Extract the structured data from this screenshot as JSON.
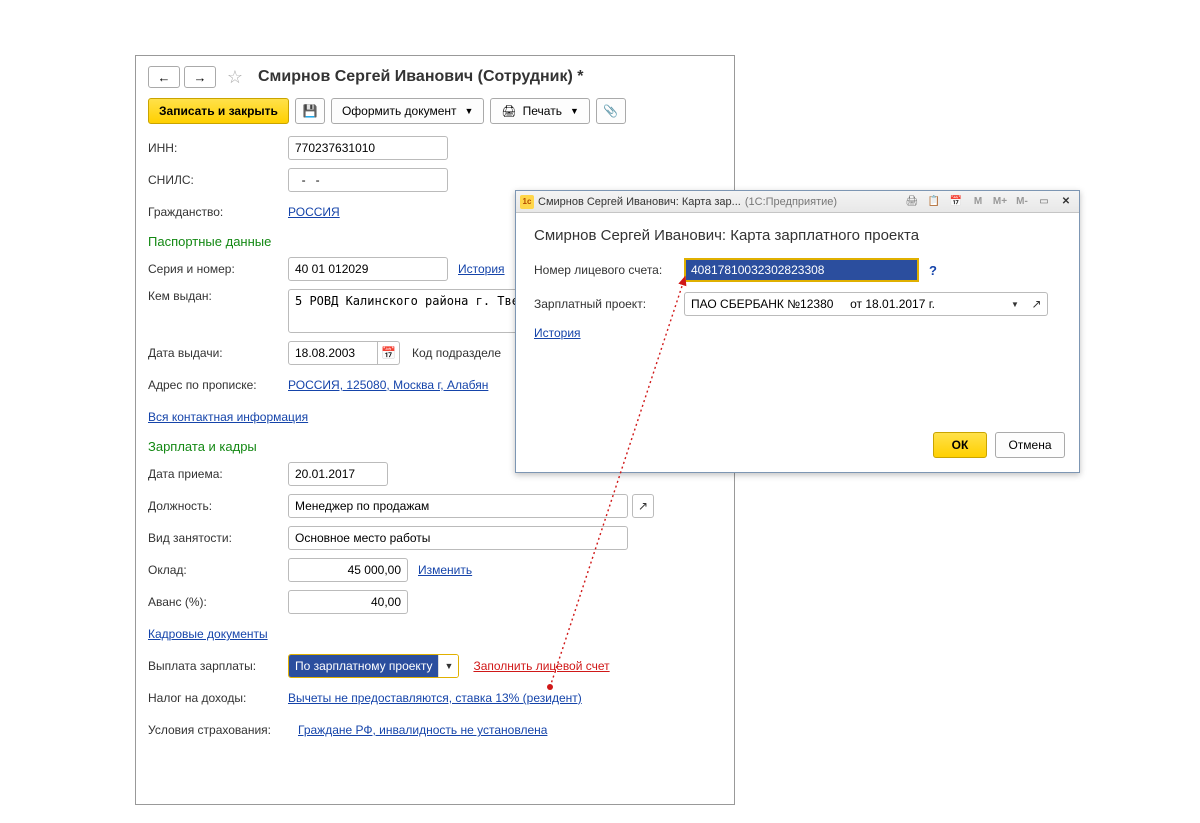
{
  "main": {
    "title": "Смирнов Сергей Иванович (Сотрудник) *",
    "toolbar": {
      "save_close": "Записать и закрыть",
      "doc_btn": "Оформить документ",
      "print_btn": "Печать"
    },
    "inn_label": "ИНН:",
    "inn_value": "770237631010",
    "snils_label": "СНИЛС:",
    "snils_value": "  -   -",
    "citizenship_label": "Гражданство:",
    "citizenship_link": "РОССИЯ",
    "passport_header": "Паспортные данные",
    "series_label": "Серия и номер:",
    "series_value": "40 01 012029",
    "history_link": "История",
    "issued_label": "Кем выдан:",
    "issued_value": "5 РОВД Калинского района г. Тверь",
    "issue_date_label": "Дата выдачи:",
    "issue_date_value": "18.08.2003",
    "dept_code_label": "Код подразделе",
    "address_label": "Адрес по прописке:",
    "address_link": "РОССИЯ, 125080, Москва г, Алабян",
    "all_contacts_link": "Вся контактная информация",
    "salary_header": "Зарплата и кадры",
    "hire_date_label": "Дата приема:",
    "hire_date_value": "20.01.2017",
    "position_label": "Должность:",
    "position_value": "Менеджер по продажам",
    "employment_label": "Вид занятости:",
    "employment_value": "Основное место работы",
    "salary_label": "Оклад:",
    "salary_value": "45 000,00",
    "change_link": "Изменить",
    "advance_label": "Аванс (%):",
    "advance_value": "40,00",
    "hr_docs_link": "Кадровые документы",
    "payout_label": "Выплата зарплаты:",
    "payout_value": "По зарплатному проекту",
    "fill_account_link": "Заполнить лицевой счет",
    "tax_label": "Налог на доходы:",
    "tax_link": "Вычеты не предоставляются, ставка 13% (резидент)",
    "insurance_label": "Условия страхования:",
    "insurance_link": "Граждане РФ, инвалидность не установлена"
  },
  "popup": {
    "win_title": "Смирнов Сергей Иванович: Карта зар...",
    "win_app": "(1С:Предприятие)",
    "m_labels": {
      "m": "M",
      "mplus": "M+",
      "mminus": "M-"
    },
    "title": "Смирнов Сергей Иванович: Карта зарплатного проекта",
    "account_label": "Номер лицевого счета:",
    "account_value": "40817810032302823308",
    "project_label": "Зарплатный проект:",
    "project_value": "ПАО СБЕРБАНК №12380     от 18.01.2017 г.",
    "history_link": "История",
    "ok": "ОК",
    "cancel": "Отмена"
  }
}
